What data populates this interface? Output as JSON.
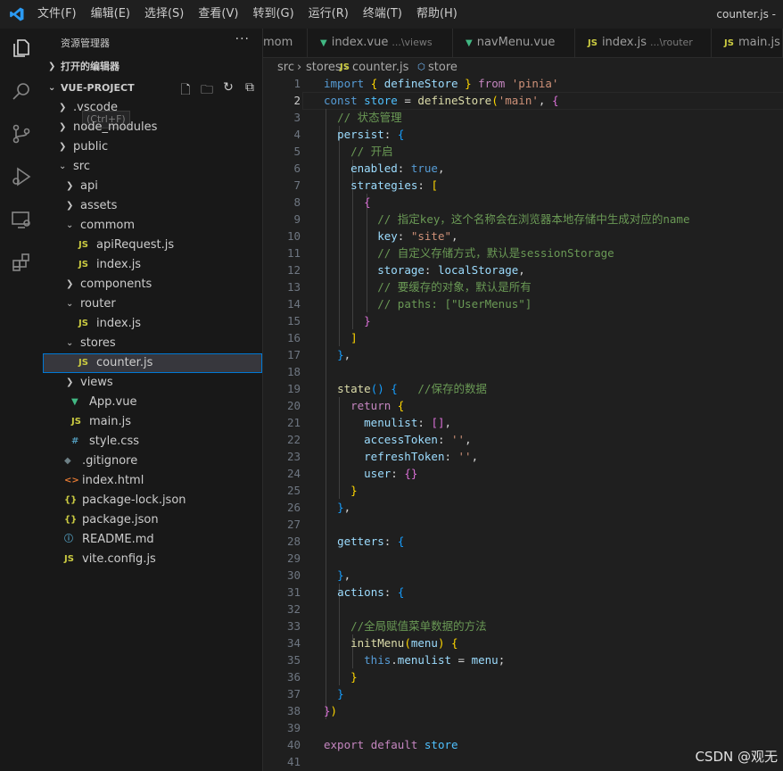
{
  "window": {
    "title": "counter.js -",
    "menu": [
      "文件(F)",
      "编辑(E)",
      "选择(S)",
      "查看(V)",
      "转到(G)",
      "运行(R)",
      "终端(T)",
      "帮助(H)"
    ]
  },
  "activity_icons": [
    "files-icon",
    "search-icon",
    "source-control-icon",
    "run-debug-icon",
    "remote-explorer-icon",
    "extensions-icon"
  ],
  "sidebar": {
    "title": "资源管理器",
    "more": "···",
    "open_editors": "打开的编辑器",
    "project": "VUE-PROJECT",
    "project_hint": "(Ctrl+F)",
    "tree": [
      {
        "name": ".vscode",
        "type": "folder",
        "open": false,
        "depth": 0
      },
      {
        "name": "node_modules",
        "type": "folder",
        "open": false,
        "depth": 0
      },
      {
        "name": "public",
        "type": "folder",
        "open": false,
        "depth": 0
      },
      {
        "name": "src",
        "type": "folder",
        "open": true,
        "depth": 0
      },
      {
        "name": "api",
        "type": "folder",
        "open": false,
        "depth": 1
      },
      {
        "name": "assets",
        "type": "folder",
        "open": false,
        "depth": 1
      },
      {
        "name": "commom",
        "type": "folder",
        "open": true,
        "depth": 1
      },
      {
        "name": "apiRequest.js",
        "type": "js",
        "depth": 2
      },
      {
        "name": "index.js",
        "type": "js",
        "depth": 2
      },
      {
        "name": "components",
        "type": "folder",
        "open": false,
        "depth": 1
      },
      {
        "name": "router",
        "type": "folder",
        "open": true,
        "depth": 1
      },
      {
        "name": "index.js",
        "type": "js",
        "depth": 2
      },
      {
        "name": "stores",
        "type": "folder",
        "open": true,
        "depth": 1
      },
      {
        "name": "counter.js",
        "type": "js",
        "depth": 2,
        "active": true
      },
      {
        "name": "views",
        "type": "folder",
        "open": false,
        "depth": 1
      },
      {
        "name": "App.vue",
        "type": "vue",
        "depth": 1
      },
      {
        "name": "main.js",
        "type": "js",
        "depth": 1
      },
      {
        "name": "style.css",
        "type": "css",
        "depth": 1
      },
      {
        "name": ".gitignore",
        "type": "git",
        "depth": 0
      },
      {
        "name": "index.html",
        "type": "html",
        "depth": 0
      },
      {
        "name": "package-lock.json",
        "type": "json",
        "depth": 0
      },
      {
        "name": "package.json",
        "type": "json",
        "depth": 0
      },
      {
        "name": "README.md",
        "type": "info",
        "depth": 0
      },
      {
        "name": "vite.config.js",
        "type": "js",
        "depth": 0
      }
    ]
  },
  "file_icons": {
    "js": {
      "glyph": "JS",
      "color": "#cbcb41"
    },
    "vue": {
      "glyph": "▼",
      "color": "#41b883"
    },
    "css": {
      "glyph": "#",
      "color": "#519aba"
    },
    "git": {
      "glyph": "◆",
      "color": "#6d8086"
    },
    "html": {
      "glyph": "<>",
      "color": "#e37933"
    },
    "json": {
      "glyph": "{}",
      "color": "#cbcb41"
    },
    "info": {
      "glyph": "ⓘ",
      "color": "#519aba"
    }
  },
  "tabs": [
    {
      "label": "mom",
      "desc": "",
      "type": "none"
    },
    {
      "label": "index.vue",
      "desc": "...\\views",
      "type": "vue"
    },
    {
      "label": "navMenu.vue",
      "desc": "",
      "type": "vue"
    },
    {
      "label": "index.js",
      "desc": "...\\router",
      "type": "js"
    },
    {
      "label": "main.js",
      "desc": "",
      "type": "js"
    }
  ],
  "breadcrumb": {
    "parts": [
      "src",
      "stores",
      "counter.js",
      "store"
    ]
  },
  "editor": {
    "current_line": 2,
    "lines": [
      [
        [
          "k",
          "import"
        ],
        [
          "p",
          " "
        ],
        [
          "b1",
          "{"
        ],
        [
          "p",
          " "
        ],
        [
          "v",
          "defineStore"
        ],
        [
          "p",
          " "
        ],
        [
          "b1",
          "}"
        ],
        [
          "p",
          " "
        ],
        [
          "kc",
          "from"
        ],
        [
          "p",
          " "
        ],
        [
          "s",
          "'pinia'"
        ]
      ],
      [
        [
          "k",
          "const"
        ],
        [
          "p",
          " "
        ],
        [
          "vc",
          "store"
        ],
        [
          "p",
          " = "
        ],
        [
          "f",
          "defineStore"
        ],
        [
          "b1",
          "("
        ],
        [
          "s",
          "'main'"
        ],
        [
          "p",
          ", "
        ],
        [
          "b2",
          "{"
        ]
      ],
      [
        [
          "p",
          "  "
        ],
        [
          "c",
          "// 状态管理"
        ]
      ],
      [
        [
          "p",
          "  "
        ],
        [
          "v",
          "persist"
        ],
        [
          "p",
          ": "
        ],
        [
          "b3",
          "{"
        ]
      ],
      [
        [
          "p",
          "    "
        ],
        [
          "c",
          "// 开启"
        ]
      ],
      [
        [
          "p",
          "    "
        ],
        [
          "v",
          "enabled"
        ],
        [
          "p",
          ": "
        ],
        [
          "k",
          "true"
        ],
        [
          "p",
          ","
        ]
      ],
      [
        [
          "p",
          "    "
        ],
        [
          "v",
          "strategies"
        ],
        [
          "p",
          ": "
        ],
        [
          "b1",
          "["
        ]
      ],
      [
        [
          "p",
          "      "
        ],
        [
          "b2",
          "{"
        ]
      ],
      [
        [
          "p",
          "        "
        ],
        [
          "c",
          "// 指定key，这个名称会在浏览器本地存储中生成对应的name"
        ]
      ],
      [
        [
          "p",
          "        "
        ],
        [
          "v",
          "key"
        ],
        [
          "p",
          ": "
        ],
        [
          "s",
          "\"site\""
        ],
        [
          "p",
          ","
        ]
      ],
      [
        [
          "p",
          "        "
        ],
        [
          "c",
          "// 自定义存储方式，默认是sessionStorage"
        ]
      ],
      [
        [
          "p",
          "        "
        ],
        [
          "v",
          "storage"
        ],
        [
          "p",
          ": "
        ],
        [
          "v",
          "localStorage"
        ],
        [
          "p",
          ","
        ]
      ],
      [
        [
          "p",
          "        "
        ],
        [
          "c",
          "// 要缓存的对象，默认是所有"
        ]
      ],
      [
        [
          "p",
          "        "
        ],
        [
          "c",
          "// paths: [\"UserMenus\"]"
        ]
      ],
      [
        [
          "p",
          "      "
        ],
        [
          "b2",
          "}"
        ]
      ],
      [
        [
          "p",
          "    "
        ],
        [
          "b1",
          "]"
        ]
      ],
      [
        [
          "p",
          "  "
        ],
        [
          "b3",
          "}"
        ],
        [
          "p",
          ","
        ]
      ],
      [
        [
          "p",
          ""
        ]
      ],
      [
        [
          "p",
          "  "
        ],
        [
          "f",
          "state"
        ],
        [
          "b3",
          "()"
        ],
        [
          "p",
          " "
        ],
        [
          "b3",
          "{"
        ],
        [
          "p",
          "   "
        ],
        [
          "c",
          "//保存的数据"
        ]
      ],
      [
        [
          "p",
          "    "
        ],
        [
          "kc",
          "return"
        ],
        [
          "p",
          " "
        ],
        [
          "b1",
          "{"
        ]
      ],
      [
        [
          "p",
          "      "
        ],
        [
          "v",
          "menulist"
        ],
        [
          "p",
          ": "
        ],
        [
          "b2",
          "[]"
        ],
        [
          "p",
          ","
        ]
      ],
      [
        [
          "p",
          "      "
        ],
        [
          "v",
          "accessToken"
        ],
        [
          "p",
          ": "
        ],
        [
          "s",
          "''"
        ],
        [
          "p",
          ","
        ]
      ],
      [
        [
          "p",
          "      "
        ],
        [
          "v",
          "refreshToken"
        ],
        [
          "p",
          ": "
        ],
        [
          "s",
          "''"
        ],
        [
          "p",
          ","
        ]
      ],
      [
        [
          "p",
          "      "
        ],
        [
          "v",
          "user"
        ],
        [
          "p",
          ": "
        ],
        [
          "b2",
          "{}"
        ]
      ],
      [
        [
          "p",
          "    "
        ],
        [
          "b1",
          "}"
        ]
      ],
      [
        [
          "p",
          "  "
        ],
        [
          "b3",
          "}"
        ],
        [
          "p",
          ","
        ]
      ],
      [
        [
          "p",
          ""
        ]
      ],
      [
        [
          "p",
          "  "
        ],
        [
          "v",
          "getters"
        ],
        [
          "p",
          ": "
        ],
        [
          "b3",
          "{"
        ]
      ],
      [
        [
          "p",
          ""
        ]
      ],
      [
        [
          "p",
          "  "
        ],
        [
          "b3",
          "}"
        ],
        [
          "p",
          ","
        ]
      ],
      [
        [
          "p",
          "  "
        ],
        [
          "v",
          "actions"
        ],
        [
          "p",
          ": "
        ],
        [
          "b3",
          "{"
        ]
      ],
      [
        [
          "p",
          ""
        ]
      ],
      [
        [
          "p",
          "    "
        ],
        [
          "c",
          "//全局赋值菜单数据的方法"
        ]
      ],
      [
        [
          "p",
          "    "
        ],
        [
          "f",
          "initMenu"
        ],
        [
          "b1",
          "("
        ],
        [
          "v",
          "menu"
        ],
        [
          "b1",
          ")"
        ],
        [
          "p",
          " "
        ],
        [
          "b1",
          "{"
        ]
      ],
      [
        [
          "p",
          "      "
        ],
        [
          "k",
          "this"
        ],
        [
          "p",
          "."
        ],
        [
          "v",
          "menulist"
        ],
        [
          "p",
          " = "
        ],
        [
          "v",
          "menu"
        ],
        [
          "p",
          ";"
        ]
      ],
      [
        [
          "p",
          "    "
        ],
        [
          "b1",
          "}"
        ]
      ],
      [
        [
          "p",
          "  "
        ],
        [
          "b3",
          "}"
        ]
      ],
      [
        [
          "b2",
          "}"
        ],
        [
          "b1",
          ")"
        ]
      ],
      [
        [
          "p",
          ""
        ]
      ],
      [
        [
          "kc",
          "export"
        ],
        [
          "p",
          " "
        ],
        [
          "kc",
          "default"
        ],
        [
          "p",
          " "
        ],
        [
          "vc",
          "store"
        ]
      ],
      [
        [
          "p",
          ""
        ]
      ]
    ]
  },
  "watermark": "CSDN @观无"
}
